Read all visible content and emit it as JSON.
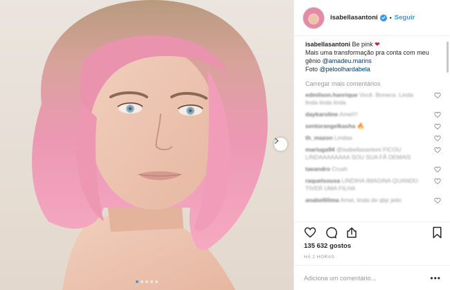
{
  "header": {
    "username": "isabellasantoni",
    "separator": "•",
    "follow_label": "Seguir"
  },
  "caption": {
    "username": "isabellasantoni",
    "text_1": "Be pink",
    "emoji": "❤",
    "text_2": "Mais uma transformação pra conta com meu gênio",
    "mention_1": "@amadeu.marins",
    "text_3": "Foto",
    "mention_2": "@peloolhardabela"
  },
  "load_more_label": "Carregar mais comentários",
  "comments": [
    {
      "user": "edmilson.hanrique",
      "text": "Você. Boneca. Linda linda linda linda"
    },
    {
      "user": "daykaroline",
      "text": "Amei!!!"
    },
    {
      "user": "sentorangelkasha",
      "text": "🔥"
    },
    {
      "user": "th_mazon",
      "text": "Lindaa"
    },
    {
      "user": "mariuga94",
      "text": "@isabellasantoni FICOU LINDAAAAAAAA SOU SUA FÃ DEMAIS"
    },
    {
      "user": "taeandro",
      "text": "Crush"
    },
    {
      "user": "raquelsousa",
      "text": "LINDIHA IMAGINA QUANDO TIVER UMA FILHA"
    },
    {
      "user": "anabellilima",
      "text": "Amei, linda de qlqr jeito"
    }
  ],
  "likes_text": "135 632 gostos",
  "time_text": "HÁ 2 HORAS",
  "comment_input": {
    "placeholder": "Adiciona um comentário..."
  },
  "more_menu_label": "•••",
  "colors": {
    "accent_blue": "#3897f0",
    "mention_blue": "#003569",
    "hair_pink": "#e88aa8",
    "border": "#efefef"
  },
  "icons": [
    "next-arrow-icon",
    "verified-badge-icon",
    "heart-icon",
    "comment-icon",
    "share-icon",
    "bookmark-icon"
  ],
  "carousel": {
    "total_slides": 5,
    "active_slide": 1
  }
}
